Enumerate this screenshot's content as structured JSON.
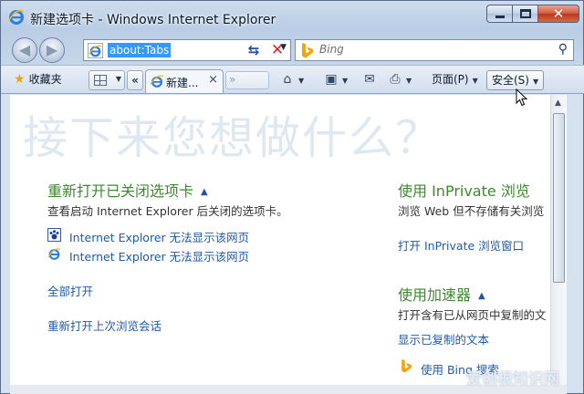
{
  "window": {
    "title": "新建选项卡 - Windows Internet Explorer"
  },
  "address": {
    "url": "about:Tabs"
  },
  "search": {
    "placeholder": "Bing"
  },
  "commandbar": {
    "favorites": "收藏夹",
    "tab_label": "新建...",
    "list_chevron": "«",
    "page_menu": "页面(P)",
    "safety_menu": "安全(S)"
  },
  "content": {
    "heading_big": "接下来您想做什么？",
    "reopen": {
      "heading": "重新打开已关闭选项卡",
      "desc": "查看启动 Internet Explorer 后关闭的选项卡。",
      "items": [
        "Internet Explorer 无法显示该网页",
        "Internet Explorer 无法显示该网页"
      ],
      "open_all": "全部打开",
      "reopen_last": "重新打开上次浏览会话"
    },
    "inprivate": {
      "heading": "使用 InPrivate 浏览",
      "desc": "浏览 Web 但不存储有关浏览",
      "link": "打开 InPrivate 浏览窗口"
    },
    "accelerators": {
      "heading": "使用加速器",
      "desc": "打开含有已从网页中复制的文",
      "show_copied": "显示已复制的文本",
      "bing_link": "使用 Bing 搜索"
    }
  },
  "watermark": "爱创根知识网",
  "colors": {
    "heading_green": "#3c8a2e",
    "link_blue": "#1e5aa8",
    "url_selected": "#3399ff"
  }
}
